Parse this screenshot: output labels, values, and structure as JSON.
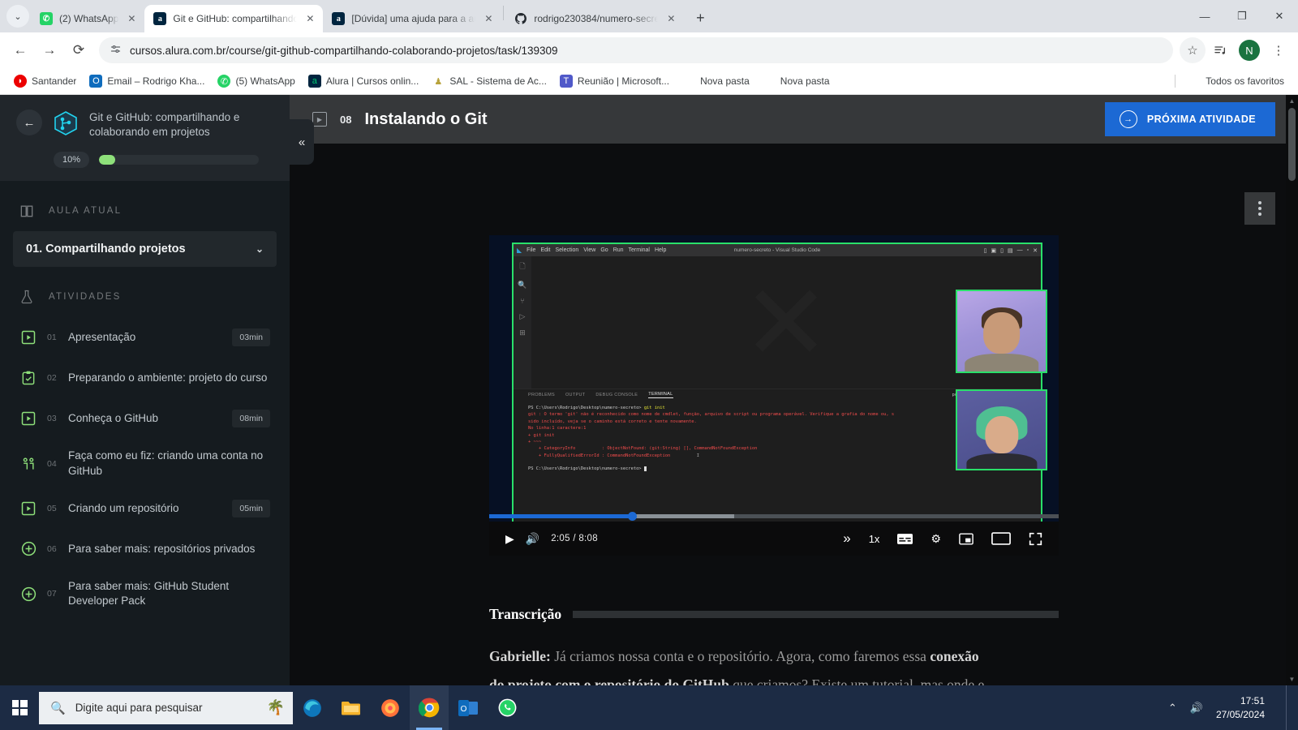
{
  "browser": {
    "tabs": [
      {
        "title": "(2) WhatsApp",
        "favicon": "whatsapp-icon",
        "active": false
      },
      {
        "title": "Git e GitHub: compartilhando e",
        "favicon": "alura-icon",
        "active": true
      },
      {
        "title": "[Dúvida] uma ajuda para a aula",
        "favicon": "alura-icon",
        "active": false
      },
      {
        "title": "rodrigo230384/numero-secreto",
        "favicon": "github-icon",
        "active": false
      }
    ],
    "new_tab_label": "+",
    "tab_list_label": "⌄",
    "window_controls": {
      "minimize": "—",
      "maximize": "❐",
      "close": "✕"
    },
    "nav": {
      "back": "←",
      "forward": "→",
      "reload": "⟳"
    },
    "omnibox": {
      "url": "cursos.alura.com.br/course/git-github-compartilhando-colaborando-projetos/task/139309",
      "site_settings_icon": "tune-icon",
      "bookmark_star_icon": "star-icon"
    },
    "toolbar_right": {
      "reading_list_icon": "reading-list-icon",
      "profile_initial": "N",
      "menu_icon": "kebab-menu-icon"
    },
    "bookmarks": [
      {
        "label": "Santander",
        "icon": "santander-icon",
        "color": "#ec0000"
      },
      {
        "label": "Email – Rodrigo Kha...",
        "icon": "outlook-icon",
        "color": "#0f6cbd"
      },
      {
        "label": "(5) WhatsApp",
        "icon": "whatsapp-icon",
        "color": "#25d366"
      },
      {
        "label": "Alura | Cursos onlin...",
        "icon": "alura-icon",
        "color": "#00253f"
      },
      {
        "label": "SAL - Sistema de Ac...",
        "icon": "sal-icon",
        "color": "#b8a33c"
      },
      {
        "label": "Reunião | Microsoft...",
        "icon": "teams-icon",
        "color": "#5059c9"
      },
      {
        "label": "Nova pasta",
        "icon": "folder-icon",
        "color": "#5f6368"
      },
      {
        "label": "Nova pasta",
        "icon": "folder-icon",
        "color": "#5f6368"
      }
    ],
    "all_bookmarks_label": "Todos os favoritos"
  },
  "sidebar": {
    "back_label": "←",
    "course_title": "Git e GitHub: compartilhando e colaborando em projetos",
    "progress_percent_label": "10%",
    "progress_percent_value": 10,
    "current_section_label": "AULA ATUAL",
    "current_lesson": "01. Compartilhando projetos",
    "current_lesson_chevron": "⌄",
    "activities_label": "ATIVIDADES",
    "activities": [
      {
        "num": "01",
        "label": "Apresentação",
        "duration": "03min",
        "icon": "video-icon"
      },
      {
        "num": "02",
        "label": "Preparando o ambiente: projeto do curso",
        "duration": "",
        "icon": "clipboard-check-icon"
      },
      {
        "num": "03",
        "label": "Conheça o GitHub",
        "duration": "08min",
        "icon": "video-icon"
      },
      {
        "num": "04",
        "label": "Faça como eu fiz: criando uma conta no GitHub",
        "duration": "",
        "icon": "people-icon"
      },
      {
        "num": "05",
        "label": "Criando um repositório",
        "duration": "05min",
        "icon": "video-icon"
      },
      {
        "num": "06",
        "label": "Para saber mais: repositórios privados",
        "duration": "",
        "icon": "plus-circle-icon"
      },
      {
        "num": "07",
        "label": "Para saber mais: GitHub Student Developer Pack",
        "duration": "",
        "icon": "plus-circle-icon"
      }
    ],
    "collapse_label": "«"
  },
  "task": {
    "number": "08",
    "title": "Instalando o Git",
    "next_button": "PRÓXIMA ATIVIDADE",
    "next_button_color": "#1c69d4",
    "options_menu_icon": "kebab-menu-icon"
  },
  "video": {
    "vscode": {
      "menus": [
        "File",
        "Edit",
        "Selection",
        "View",
        "Go",
        "Run",
        "Terminal",
        "Help"
      ],
      "window_title": "numero-secreto - Visual Studio Code",
      "panel_tabs": [
        "PROBLEMS",
        "OUTPUT",
        "DEBUG CONSOLE",
        "TERMINAL"
      ],
      "active_panel_tab": "TERMINAL",
      "shell_label": "powershell",
      "terminal_lines": [
        {
          "text": "PS C:\\Users\\Rodrigo\\Desktop\\numero-secreto> ",
          "style": "pr",
          "cmd": "git init"
        },
        {
          "text": "git : O termo 'git' não é reconhecido como nome de cmdlet, função, arquivo de script ou programa operável. Verifique a grafia do nome ou, s",
          "style": "err"
        },
        {
          "text": "sido incluído, veja se o caminho está correto e tente novamente.",
          "style": "err"
        },
        {
          "text": "No linha:1 caractere:1",
          "style": "err"
        },
        {
          "text": "+ git init",
          "style": "err"
        },
        {
          "text": "+ ~~~",
          "style": "err"
        },
        {
          "text": "    + CategoryInfo          : ObjectNotFound: (git:String) [], CommandNotFoundException",
          "style": "err"
        },
        {
          "text": "    + FullyQualifiedErrorId : CommandNotFoundException",
          "style": "err"
        },
        {
          "text": "",
          "style": "pr"
        },
        {
          "text": "PS C:\\Users\\Rodrigo\\Desktop\\numero-secreto> ",
          "style": "pr",
          "cmd": ""
        }
      ]
    },
    "player": {
      "play_icon": "play-icon",
      "volume_icon": "volume-icon",
      "current_time": "2:05",
      "separator": "/",
      "duration": "8:08",
      "skip_icon": "skip-forward-icon",
      "speed": "1x",
      "captions_icon": "captions-icon",
      "settings_icon": "gear-icon",
      "pip_icon": "picture-in-picture-icon",
      "theater_icon": "theater-mode-icon",
      "fullscreen_icon": "fullscreen-icon",
      "progress_played_percent": 25,
      "progress_buffered_percent": 43
    }
  },
  "transcription": {
    "heading": "Transcrição",
    "speaker": "Gabrielle",
    "speaker_sep": ":",
    "part1": " Já criamos nossa conta e o repositório. Agora, como faremos essa ",
    "bold": "conexão do projeto com o repositório do GitHub",
    "part2": " que criamos? Existe um tutorial, mas onde e como executamos esses comandos?"
  },
  "taskbar": {
    "start_icon": "windows-start-icon",
    "search_placeholder": "Digite aqui para pesquisar",
    "search_icon": "search-icon",
    "apps": [
      {
        "name": "microsoft-edge-icon",
        "glyph": "e",
        "color": "#0e77bb",
        "active": false
      },
      {
        "name": "file-explorer-icon",
        "glyph": "▤",
        "color": "#f7b32b",
        "active": false
      },
      {
        "name": "firefox-icon",
        "glyph": "◉",
        "color": "#ff7139",
        "active": false
      },
      {
        "name": "google-chrome-icon",
        "glyph": "◉",
        "color": "#4285f4",
        "active": true
      },
      {
        "name": "outlook-icon",
        "glyph": "O",
        "color": "#0f6cbd",
        "active": false
      },
      {
        "name": "whatsapp-icon",
        "glyph": "✆",
        "color": "#25d366",
        "active": false
      }
    ],
    "tray": {
      "chevron": "⌃",
      "volume_icon": "speaker-icon"
    },
    "time": "17:51",
    "date": "27/05/2024"
  }
}
